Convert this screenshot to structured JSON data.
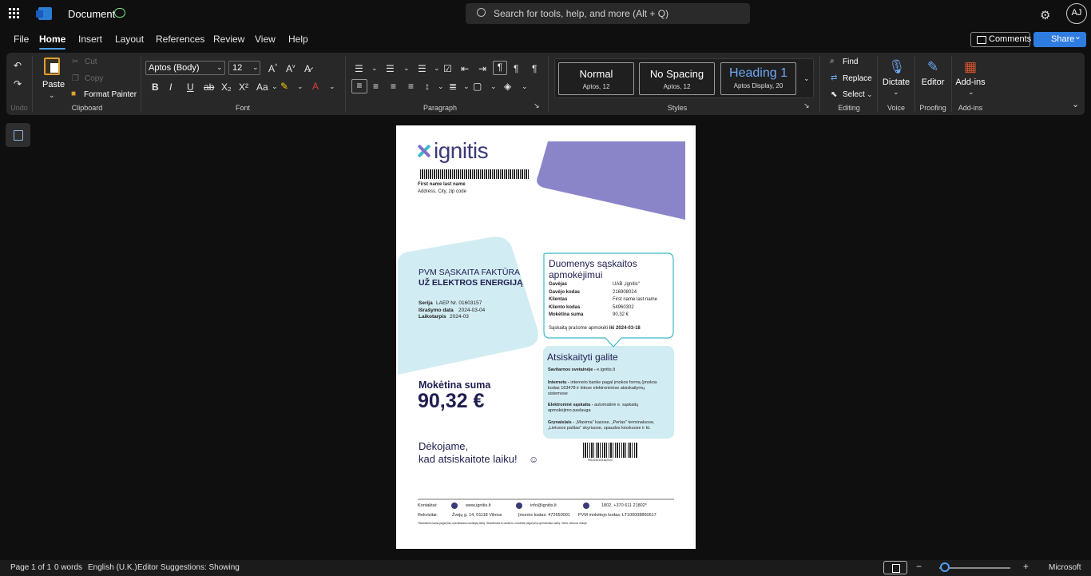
{
  "app": {
    "doc_title": "Document"
  },
  "search": {
    "placeholder": "Search for tools, help, and more (Alt + Q)"
  },
  "user": {
    "initials": "AJ"
  },
  "menu": {
    "tabs": [
      "File",
      "Home",
      "Insert",
      "Layout",
      "References",
      "Review",
      "View",
      "Help"
    ],
    "active": "Home"
  },
  "actions": {
    "comments": "Comments",
    "share": "Share"
  },
  "ribbon": {
    "undo_label": "Undo",
    "clipboard": {
      "paste": "Paste",
      "cut": "Cut",
      "copy": "Copy",
      "format_painter": "Format Painter",
      "label": "Clipboard"
    },
    "font": {
      "family": "Aptos (Body)",
      "size": "12",
      "label": "Font"
    },
    "paragraph": {
      "label": "Paragraph"
    },
    "styles": {
      "items": [
        {
          "name": "Normal",
          "sub": "Aptos, 12"
        },
        {
          "name": "No Spacing",
          "sub": "Aptos, 12"
        },
        {
          "name": "Heading 1",
          "sub": "Aptos Display, 20"
        }
      ],
      "label": "Styles"
    },
    "editing": {
      "find": "Find",
      "replace": "Replace",
      "select": "Select",
      "label": "Editing"
    },
    "voice": {
      "dictate": "Dictate",
      "label": "Voice"
    },
    "proofing": {
      "editor": "Editor",
      "label": "Proofing"
    },
    "addins": {
      "addins": "Add-ins",
      "label": "Add-ins"
    }
  },
  "invoice": {
    "brand": "ignitis",
    "recipient_name": "First name last name",
    "recipient_address": "Address, City, zip code",
    "title_line1": "PVM SĄSKAITA FAKTŪRA",
    "title_line2": "UŽ ELEKTROS ENERGIJĄ",
    "series_label": "Serija",
    "series_value": "LAEP  Nr.  01603157",
    "issue_label": "Išrašymo  data",
    "issue_value": "2024-03-04",
    "period_label": "Laikotarpis",
    "period_value": "2024-03",
    "payment_box_title": "Duomenys sąskaitos apmokėjimui",
    "payment_rows": [
      {
        "k": "Gavėjas",
        "v": "UAB „Ignitis\""
      },
      {
        "k": "Gavėjo kodas",
        "v": "216908024"
      },
      {
        "k": "Klientas",
        "v": "First name last name"
      },
      {
        "k": "Kliento kodas",
        "v": "54960302"
      },
      {
        "k": "Mokėtina suma",
        "v": "90,32  €"
      }
    ],
    "due_text": "Sąskaitą prašome apmokėti",
    "due_date": "iki 2024-03-18",
    "settle_title": "Atsiskaityti galite",
    "settle_items": [
      {
        "b": "Savitarnos svetainėje -",
        "t": "e.ignitis.lt"
      },
      {
        "b": "Internetu -",
        "t": "interneto banke pagal įmokos formą (įmokos kodas 163478 ir kitose elektroninėse atsiskaitymų sistemose"
      },
      {
        "b": "Elektroninė sąskaita -",
        "t": "automatinė e. sąskaitų apmokėjimo paslauga"
      },
      {
        "b": "Grynaisiais -",
        "t": "„Maxima\" kasose, „Perlas\" terminaluose, „Lietuvos paštas\" skyriuose, spaudos kioskuose ir kt."
      }
    ],
    "amount_label": "Mokėtina suma",
    "amount_value": "90,32 €",
    "thanks_line1": "Dėkojame,",
    "thanks_line2": "kad atsiskaitote laiku!",
    "smiley": "☺",
    "barcode_caption": "9911630103162024",
    "footer_contacts_label": "Kontaktai:",
    "footer_web": "www.ignitis.lt",
    "footer_email": "info@ignitis.lt",
    "footer_phone": "1802, +370 611 21802*",
    "footer_req_label": "Rekvizitai:",
    "footer_address": "Žvejų g. 14, 01118 Vilnius",
    "footer_company_code": "Įmonės kodas: 472650001",
    "footer_vat": "PVM mokėtojo kodas: LT100008860617",
    "footer_note": "*Skambučio kaina pagal jūsų operatoriaus nustatytą tarifą. Skambinant iš užsienio, mokėsite pagal jūsų operatoriaus tarifą. Tarifa Lietuvos rinkoje."
  },
  "status": {
    "page": "Page 1 of 1",
    "words": "0 words",
    "language": "English (U.K.)",
    "editor": "Editor Suggestions: Showing",
    "brand": "Microsoft"
  },
  "colors": {
    "accent": "#2f7ce0",
    "lavender": "#8a85c8",
    "lightblue": "#d2ecf3",
    "teal": "#3fb8c8"
  }
}
